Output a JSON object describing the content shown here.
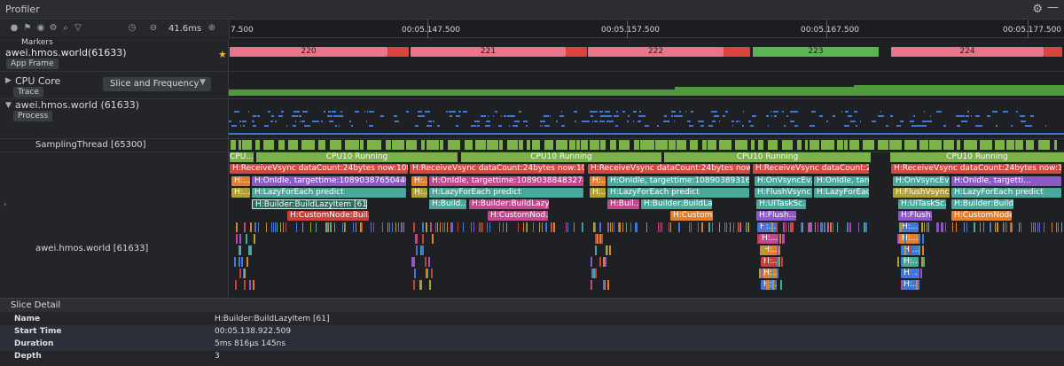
{
  "window": {
    "title": "Profiler"
  },
  "toolbar": {
    "zoom": "41.6ms"
  },
  "ruler": {
    "ticks": [
      "7.500",
      "00:05.147.500",
      "00:05.157.500",
      "00:05.167.500",
      "00:05.177.500"
    ]
  },
  "tracks": {
    "markers_label": "Markers",
    "app_name": "awei.hmos.world(61633)",
    "app_tag": "App Frame",
    "cpu_label": "CPU Core",
    "cpu_tag": "Trace",
    "mode_select": "Slice and Frequency",
    "process_label": "awei.hmos.world (61633)",
    "process_tag": "Process",
    "sampling_label": "SamplingThread [65300]",
    "main_thread_label": "awei.hmos.world [61633]"
  },
  "frames": [
    "220",
    "221",
    "222",
    "223",
    "224"
  ],
  "running": {
    "short": "CPU...",
    "long": "CPU10 Running",
    "truncated": "Runna...",
    "ellipsis": "..."
  },
  "slices": {
    "vsync_full": "H:ReceiveVsync dataCount:24bytes now:10890...",
    "vsync_mid": "H:ReceiveVsync dataCount:24bytes now:10890...",
    "vsync_b": "H:ReceiveVsync dataCount:24bytes now:10890...",
    "vsync_c": "H:ReceiveVsync dataCount:24...",
    "vsync_d": "H:ReceiveVsync dataCount:24bytes now:108...",
    "idle1": "H:OnIdle, targettime:108903876504405",
    "idle2": "H:OnIdle, targettime:108903884832788",
    "idle3": "H:OnIdle, targettime:108903893161 0...",
    "onvsync": "H:OnVsyncEv...",
    "onidle_short": "H:OnIdle, targ...",
    "onvsync2": "H:OnVsyncEv...",
    "onidle_short2": "H:OnIdle, targetti...",
    "h_short": "H:...",
    "lazy1": "H:LazyForEach predict",
    "lazy2": "H:LazyForEach predict",
    "lazy3": "H:LazyForEach predict",
    "lazy4": "H:LazyForEach predict",
    "flush1": "H:FlushVsync",
    "flush2": "H:FlushVsync",
    "lazy_short": "H:LazyForEac...",
    "builder_sel": "H:Builder:BuildLazyItem [61]",
    "builder2": "H:Build...",
    "builder3": "H:Builder:BuildLazy...",
    "builder4": "H:Buil...",
    "builder5": "H:Builder:BuildLa...",
    "builder6": "H:Builder:BuildL...",
    "uitask1": "H:UITaskSc...",
    "uitask2": "H:UITaskSc...",
    "custom1": "H:CustomNode:Buil...",
    "custom2": "H:CustomNod...",
    "custom3": "H:CustomN...",
    "custom4": "H:CustomNode...",
    "flush_sh": "H:Flush...",
    "flush_sh2": "H:Flush...",
    "h_dots": "H:..."
  },
  "detail": {
    "header": "Slice Detail",
    "rows": [
      {
        "key": "Name",
        "value": "H:Builder:BuildLazyItem [61]"
      },
      {
        "key": "Start Time",
        "value": "00:05.138.922.509"
      },
      {
        "key": "Duration",
        "value": "5ms 816μs 145ns"
      },
      {
        "key": "Depth",
        "value": "3"
      }
    ]
  },
  "colors": {
    "frame_pink": "#e8758a",
    "frame_red": "#d9443c",
    "frame_green": "#5bb552",
    "running_green": "#7bb34a",
    "vsync_red": "#d2473f",
    "idle_purple": "#8d58c7",
    "lazy_teal": "#4aa89a",
    "builder_magenta": "#c2488e",
    "custom_red": "#c8403a",
    "cpu_freq_green": "#4f9a3d",
    "blue_lane": "#3f78d8"
  }
}
